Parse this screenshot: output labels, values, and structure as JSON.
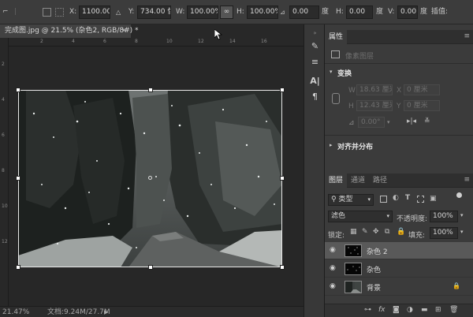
{
  "options_bar": {
    "x_label": "X:",
    "x_value": "1100.00 像素",
    "y_label": "Y:",
    "y_value": "734.00 像素",
    "w_label": "W:",
    "w_value": "100.00%",
    "h_label": "H:",
    "h_value": "100.00%",
    "angle_value": "0.00",
    "angle_unit": "度",
    "hskew_label": "H:",
    "hskew_value": "0.00",
    "hskew_unit": "度",
    "vskew_label": "V:",
    "vskew_value": "0.00",
    "vskew_unit": "度",
    "interp_value": "插值:"
  },
  "document_tab": {
    "title": "完成图.jpg @ 21.5% (杂色2, RGB/8#) *",
    "close": "×"
  },
  "status_bar": {
    "zoom": "21.47%",
    "doc_info": "文档:9.24M/27.7M",
    "arrow": "▶"
  },
  "properties_panel": {
    "tab": "属性",
    "layer_kind": "像素图层",
    "transform_header": "变换",
    "w_label": "W",
    "w_value": "18.63 厘米",
    "x_label": "X",
    "x_value": "0 厘米",
    "h_label": "H",
    "h_value": "12.43 厘米",
    "y_label": "Y",
    "y_value": "0 厘米",
    "angle_value": "0.00°",
    "align_header": "对齐并分布"
  },
  "layers_panel": {
    "tabs": [
      "图层",
      "通道",
      "路径"
    ],
    "filter_label": "类型",
    "blend_mode": "滤色",
    "opacity_label": "不透明度:",
    "opacity_value": "100%",
    "lock_label": "锁定:",
    "fill_label": "填充:",
    "fill_value": "100%",
    "layers": [
      {
        "name": "杂色 2",
        "selected": true,
        "locked": false,
        "thumb": "noise"
      },
      {
        "name": "杂色",
        "selected": false,
        "locked": false,
        "thumb": "noise"
      },
      {
        "name": "背景",
        "selected": false,
        "locked": true,
        "thumb": "forest"
      }
    ],
    "bottom_icons": [
      "link-icon",
      "fx-icon",
      "mask-icon",
      "adjustment-icon",
      "group-icon",
      "new-layer-icon",
      "trash-icon"
    ]
  },
  "ruler_labels_h": [
    "2",
    "4",
    "6",
    "8",
    "10",
    "12",
    "14",
    "16"
  ],
  "ruler_labels_v": [
    "2",
    "4",
    "6",
    "8",
    "10",
    "12"
  ],
  "colors": {
    "accent_selected_layer": "#595959",
    "panel_bg": "#3b3b3b",
    "canvas_bg": "#272727"
  }
}
